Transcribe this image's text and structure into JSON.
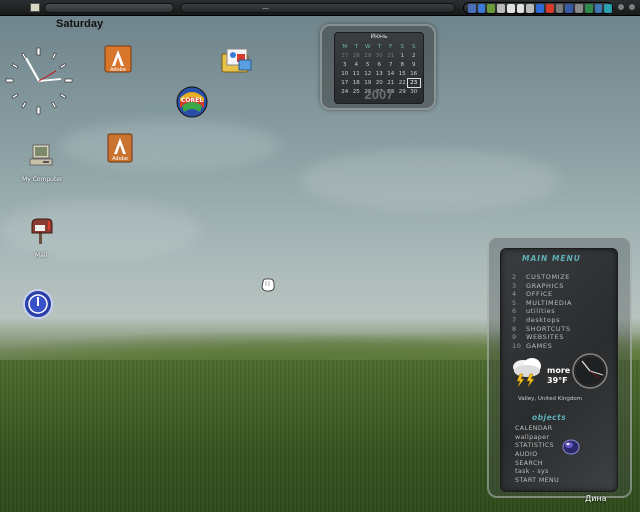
{
  "taskbar": {
    "dash": "—",
    "tray_colors": [
      "#4b6fb8",
      "#3a7ad6",
      "#6a9a3a",
      "#bbbbbb",
      "#e0e0e0",
      "#e0e0e0",
      "#bbbbbb",
      "#2b6bd6",
      "#d63b2b",
      "#7a7a7a",
      "#3a5aa8",
      "#8a8a8a",
      "#2f8a4a",
      "#3d7ab5",
      "#2aa0b0"
    ]
  },
  "desktop": {
    "day": "Saturday",
    "icons": [
      {
        "name": "adobe-icon",
        "label": ""
      },
      {
        "name": "adobe-icon",
        "label": ""
      },
      {
        "name": "corel-icon",
        "label": ""
      },
      {
        "name": "folder-image-icon",
        "label": ""
      },
      {
        "name": "my-computer-icon",
        "label": "My Computer"
      },
      {
        "name": "mail-icon",
        "label": "Mail"
      },
      {
        "name": "power-icon",
        "label": ""
      }
    ]
  },
  "calendar": {
    "month": "Июнь",
    "year": "2007",
    "headers": [
      "M",
      "T",
      "W",
      "T",
      "F",
      "S",
      "S"
    ],
    "days": [
      [
        "27",
        "28",
        "29",
        "30",
        "31",
        "1",
        "2"
      ],
      [
        "3",
        "4",
        "5",
        "6",
        "7",
        "8",
        "9"
      ],
      [
        "10",
        "11",
        "12",
        "13",
        "14",
        "15",
        "16"
      ],
      [
        "17",
        "18",
        "19",
        "20",
        "21",
        "22",
        "23"
      ],
      [
        "24",
        "25",
        "26",
        "27",
        "28",
        "29",
        "30"
      ]
    ],
    "today": "23"
  },
  "main_menu": {
    "title": "MAIN MENU",
    "items": [
      {
        "num": "2",
        "label": "CUSTOMIZE"
      },
      {
        "num": "3",
        "label": "GRAPHICS"
      },
      {
        "num": "4",
        "label": "OFFICE"
      },
      {
        "num": "5",
        "label": "MULTIMEDIA"
      },
      {
        "num": "6",
        "label": "utilities"
      },
      {
        "num": "7",
        "label": "desktops"
      },
      {
        "num": "8",
        "label": "SHORTCUTS"
      },
      {
        "num": "9",
        "label": "WEBSITES"
      },
      {
        "num": "10",
        "label": "GAMES"
      }
    ],
    "weather": {
      "more": "more",
      "temp": "39°F",
      "location": "Valley, United Kingdom"
    },
    "objects_title": "objects",
    "objects": [
      "CALENDAR",
      "wallpaper",
      "STATISTICS",
      "AUDIO",
      "SEARCH",
      "task - sys",
      "START MENU"
    ],
    "accent": "#5fb0b8"
  },
  "user": {
    "name": "Дина"
  }
}
